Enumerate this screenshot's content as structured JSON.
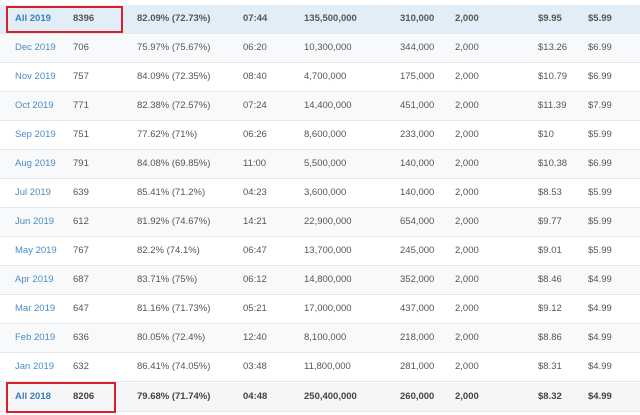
{
  "accent_color": "#4b8cc3",
  "highlight_box_color": "#d8202a",
  "rows": [
    {
      "month": "All 2019",
      "count": "8396",
      "pct": "82.09% (72.73%)",
      "time": "07:44",
      "views": "135,500,000",
      "subs": "310,000",
      "limit": "2,000",
      "price1": "$9.95",
      "price2": "$5.99"
    },
    {
      "month": "Dec 2019",
      "count": "706",
      "pct": "75.97% (75.67%)",
      "time": "06:20",
      "views": "10,300,000",
      "subs": "344,000",
      "limit": "2,000",
      "price1": "$13.26",
      "price2": "$6.99"
    },
    {
      "month": "Nov 2019",
      "count": "757",
      "pct": "84.09% (72.35%)",
      "time": "08:40",
      "views": "4,700,000",
      "subs": "175,000",
      "limit": "2,000",
      "price1": "$10.79",
      "price2": "$6.99"
    },
    {
      "month": "Oct 2019",
      "count": "771",
      "pct": "82.38% (72.57%)",
      "time": "07:24",
      "views": "14,400,000",
      "subs": "451,000",
      "limit": "2,000",
      "price1": "$11.39",
      "price2": "$7.99"
    },
    {
      "month": "Sep 2019",
      "count": "751",
      "pct": "77.62% (71%)",
      "time": "06:26",
      "views": "8,600,000",
      "subs": "233,000",
      "limit": "2,000",
      "price1": "$10",
      "price2": "$5.99"
    },
    {
      "month": "Aug 2019",
      "count": "791",
      "pct": "84.08% (69.85%)",
      "time": "11:00",
      "views": "5,500,000",
      "subs": "140,000",
      "limit": "2,000",
      "price1": "$10.38",
      "price2": "$6.99"
    },
    {
      "month": "Jul 2019",
      "count": "639",
      "pct": "85.41% (71.2%)",
      "time": "04:23",
      "views": "3,600,000",
      "subs": "140,000",
      "limit": "2,000",
      "price1": "$8.53",
      "price2": "$5.99"
    },
    {
      "month": "Jun 2019",
      "count": "612",
      "pct": "81.92% (74.67%)",
      "time": "14:21",
      "views": "22,900,000",
      "subs": "654,000",
      "limit": "2,000",
      "price1": "$9.77",
      "price2": "$5.99"
    },
    {
      "month": "May 2019",
      "count": "767",
      "pct": "82.2% (74.1%)",
      "time": "06:47",
      "views": "13,700,000",
      "subs": "245,000",
      "limit": "2,000",
      "price1": "$9.01",
      "price2": "$5.99"
    },
    {
      "month": "Apr 2019",
      "count": "687",
      "pct": "83.71% (75%)",
      "time": "06:12",
      "views": "14,800,000",
      "subs": "352,000",
      "limit": "2,000",
      "price1": "$8.46",
      "price2": "$4.99"
    },
    {
      "month": "Mar 2019",
      "count": "647",
      "pct": "81.16% (71.73%)",
      "time": "05:21",
      "views": "17,000,000",
      "subs": "437,000",
      "limit": "2,000",
      "price1": "$9.12",
      "price2": "$4.99"
    },
    {
      "month": "Feb 2019",
      "count": "636",
      "pct": "80.05% (72.4%)",
      "time": "12:40",
      "views": "8,100,000",
      "subs": "218,000",
      "limit": "2,000",
      "price1": "$8.86",
      "price2": "$4.99"
    },
    {
      "month": "Jan 2019",
      "count": "632",
      "pct": "86.41% (74.05%)",
      "time": "03:48",
      "views": "11,800,000",
      "subs": "281,000",
      "limit": "2,000",
      "price1": "$8.31",
      "price2": "$4.99"
    },
    {
      "month": "All 2018",
      "count": "8206",
      "pct": "79.68% (71.74%)",
      "time": "04:48",
      "views": "250,400,000",
      "subs": "260,000",
      "limit": "2,000",
      "price1": "$8.32",
      "price2": "$4.99"
    }
  ]
}
